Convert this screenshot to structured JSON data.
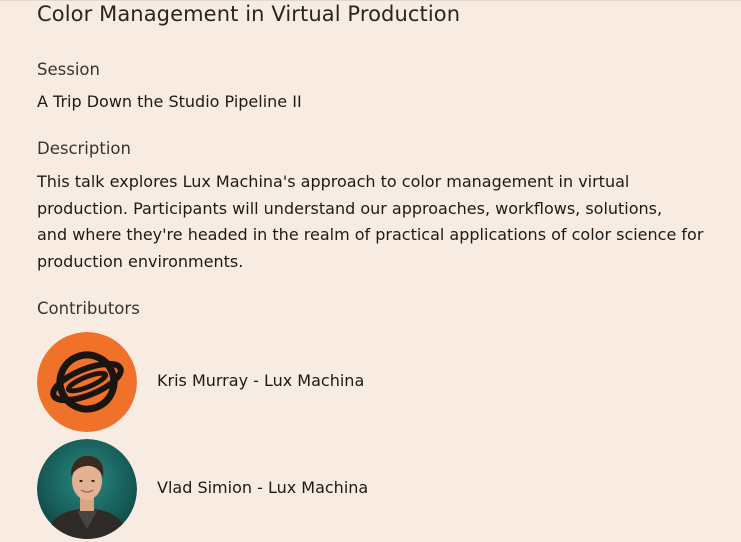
{
  "title": "Color Management in Virtual Production",
  "session": {
    "label": "Session",
    "value": "A Trip Down the Studio Pipeline II"
  },
  "description": {
    "label": "Description",
    "lines": [
      "This talk explores Lux Machina's approach to color management in virtual",
      "production. Participants will understand our approaches, workflows, solutions,",
      "and where they're headed in the realm of practical applications of color science for",
      "production environments."
    ]
  },
  "contributors": {
    "label": "Contributors",
    "items": [
      {
        "name": "Kris Murray - Lux Machina",
        "avatar_icon": "lux-machina-logo-icon",
        "avatar_color": "#f0712a"
      },
      {
        "name": "Vlad Simion - Lux Machina",
        "avatar_icon": "person-photo-avatar",
        "avatar_color": "#1d6b66"
      }
    ]
  },
  "colors": {
    "background": "#f7ebe2",
    "text": "#1e1a18"
  }
}
